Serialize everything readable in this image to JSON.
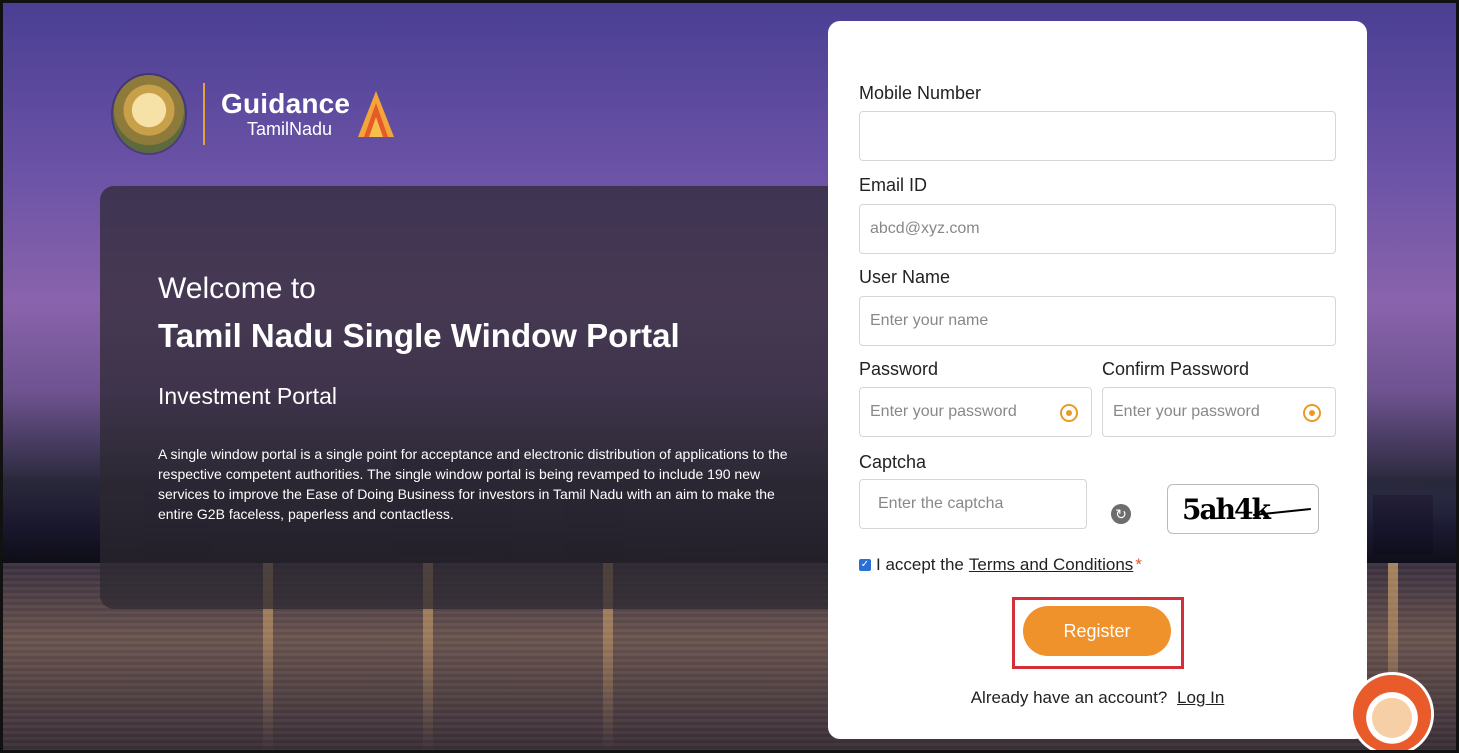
{
  "brand": {
    "guidance": "Guidance",
    "tamilnadu": "TamilNadu",
    "accent": "#f0922b"
  },
  "welcome": {
    "line1": "Welcome to",
    "line2": "Tamil Nadu Single Window Portal",
    "line3": "Investment Portal",
    "description": "A single window portal is a single point for acceptance and electronic distribution of applications to the respective competent authorities. The single window portal is being revamped to include 190 new services to improve the Ease of Doing Business for investors in Tamil Nadu with an aim to make the entire G2B faceless, paperless and contactless."
  },
  "form": {
    "mobile": {
      "label": "Mobile Number",
      "value": "",
      "placeholder": ""
    },
    "email": {
      "label": "Email ID",
      "value": "",
      "placeholder": "abcd@xyz.com"
    },
    "username": {
      "label": "User Name",
      "value": "",
      "placeholder": "Enter your name"
    },
    "password": {
      "label": "Password",
      "value": "",
      "placeholder": "Enter your password"
    },
    "confirm_password": {
      "label": "Confirm Password",
      "value": "",
      "placeholder": "Enter your password"
    },
    "captcha": {
      "label": "Captcha",
      "value": "",
      "placeholder": "Enter the captcha",
      "image_text": "5ah4k"
    },
    "terms": {
      "prefix": "I accept the",
      "link": "Terms and Conditions",
      "required_mark": "*",
      "checked": true
    },
    "register_label": "Register",
    "login_prompt": "Already have an account?",
    "login_link": "Log In"
  },
  "icons": {
    "eye": "eye-icon",
    "refresh": "refresh-icon",
    "mascot": "assistant-avatar-icon"
  }
}
